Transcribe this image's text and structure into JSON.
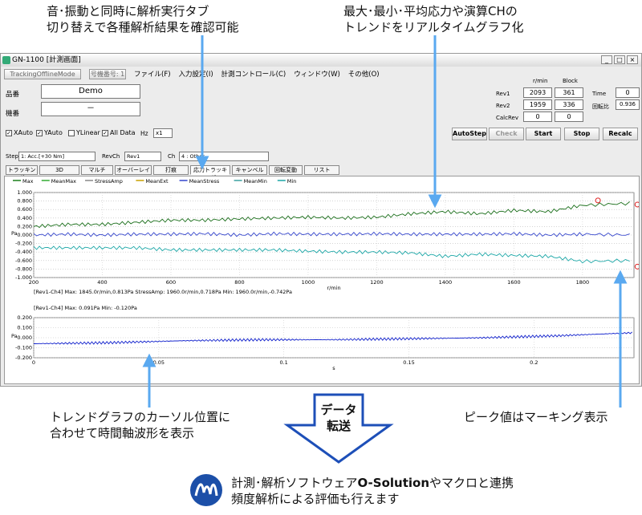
{
  "callouts": {
    "top_left": [
      "音･振動と同時に解析実行タブ",
      "切り替えで各種解析結果を確認可能"
    ],
    "top_right": [
      "最大･最小･平均応力や演算CHの",
      "トレンドをリアルタイムグラフ化"
    ],
    "bottom_left": [
      "トレンドグラフのカーソル位置に",
      "合わせて時間軸波形を表示"
    ],
    "bottom_right": "ピーク値はマーキング表示",
    "arrow": [
      "データ",
      "転送"
    ],
    "product_prefix": "計測･解析ソフトウェア",
    "product_name": "O-Solution",
    "product_suffix": "やマクロと連携",
    "product_line2": "頻度解析による評価も行えます"
  },
  "window": {
    "title": "GN-1100 [計測画面]",
    "mode_button": "TrackingOfflineMode",
    "machine_no": "号機番号: 1",
    "menu": [
      "ファイル(F)",
      "入力設定(I)",
      "計測コントロール(C)",
      "ウィンドウ(W)",
      "その他(O)"
    ],
    "part_label": "品番",
    "part_value": "Demo",
    "model_label": "機番",
    "model_value": "－",
    "col_rmin": "r/min",
    "col_block": "Block",
    "rev1_label": "Rev1",
    "rev1_rmin": "2093",
    "rev1_block": "361",
    "rev2_label": "Rev2",
    "rev2_rmin": "1959",
    "rev2_block": "336",
    "calc_label": "CalcRev",
    "calc_rmin": "0",
    "calc_block": "0",
    "time_label": "Time",
    "time_value": "0",
    "ratio_label": "回転比",
    "ratio_value": "0.936",
    "checks": [
      "XAuto",
      "YAuto",
      "YLinear",
      "All Data"
    ],
    "hz_label": "Hz",
    "hz_value": "x1",
    "buttons": [
      "AutoStep",
      "Check",
      "Start",
      "Stop",
      "Recalc"
    ],
    "step_label": "Step",
    "step_value": "1: Acc.[+30 Nm]",
    "revch_label": "RevCh",
    "revch_value": "Rev1",
    "ch_label": "Ch",
    "ch_value": "4 : Other",
    "tabs": [
      "トラッキング",
      "3D",
      "マルチ",
      "オーバーレイ",
      "打痕",
      "応力トラッキング",
      "キャンベル",
      "回転変動",
      "リスト"
    ],
    "legend": [
      "Max",
      "MeanMax",
      "StressAmp",
      "MeanExt",
      "MeanStress",
      "MeanMin",
      "Min"
    ],
    "info1": "[Rev1-Ch4]  Max: 1845.0r/min,0.813Pa  StressAmp: 1960.0r/min,0.718Pa  Min: 1960.0r/min,-0.742Pa",
    "info2": "[Rev1-Ch4]  Max: 0.091Pa  Min: -0.120Pa"
  },
  "chart_data": [
    {
      "type": "line",
      "ylabel": "Pa",
      "xlabel": "r/min",
      "xlim": [
        200,
        1950
      ],
      "ylim": [
        -1.0,
        1.0
      ],
      "x_ticks": [
        "200",
        "400",
        "600",
        "800",
        "1000",
        "1200",
        "1400",
        "1600",
        "1800"
      ],
      "y_ticks": [
        "1.000",
        "0.800",
        "0.600",
        "0.400",
        "0.200",
        "0.000",
        "-0.200",
        "-0.400",
        "-0.600",
        "-0.800",
        "-1.000"
      ],
      "x": [
        200,
        300,
        400,
        500,
        600,
        700,
        800,
        900,
        1000,
        1100,
        1200,
        1300,
        1400,
        1500,
        1600,
        1700,
        1800,
        1950
      ],
      "series": [
        {
          "name": "Max",
          "values": [
            0.2,
            0.25,
            0.25,
            0.3,
            0.35,
            0.35,
            0.38,
            0.4,
            0.42,
            0.4,
            0.42,
            0.5,
            0.55,
            0.5,
            0.58,
            0.55,
            0.7,
            0.75
          ]
        },
        {
          "name": "MeanStress",
          "values": [
            0.0,
            0.02,
            0.0,
            0.02,
            0.02,
            0.03,
            0.0,
            0.03,
            0.02,
            0.02,
            0.03,
            0.02,
            0.02,
            0.02,
            0.03,
            0.0,
            0.02,
            0.0
          ]
        },
        {
          "name": "Min",
          "values": [
            -0.3,
            -0.3,
            -0.3,
            -0.3,
            -0.35,
            -0.35,
            -0.35,
            -0.35,
            -0.38,
            -0.4,
            -0.4,
            -0.42,
            -0.5,
            -0.45,
            -0.48,
            -0.5,
            -0.62,
            -0.6
          ]
        }
      ]
    },
    {
      "type": "line",
      "ylabel": "Pa",
      "xlabel": "s",
      "xlim": [
        0,
        0.24
      ],
      "ylim": [
        -0.2,
        0.2
      ],
      "x_ticks": [
        "0",
        "0.05",
        "0.1",
        "0.15",
        "0.2"
      ],
      "y_ticks": [
        "0.200",
        "0.100",
        "0.000",
        "-0.100",
        "-0.200"
      ],
      "x": [
        0,
        0.03,
        0.06,
        0.09,
        0.12,
        0.15,
        0.18,
        0.21,
        0.24
      ],
      "series": [
        {
          "name": "",
          "values": [
            -0.06,
            -0.05,
            -0.03,
            -0.02,
            -0.02,
            -0.01,
            0.0,
            0.02,
            0.05
          ]
        }
      ]
    }
  ]
}
